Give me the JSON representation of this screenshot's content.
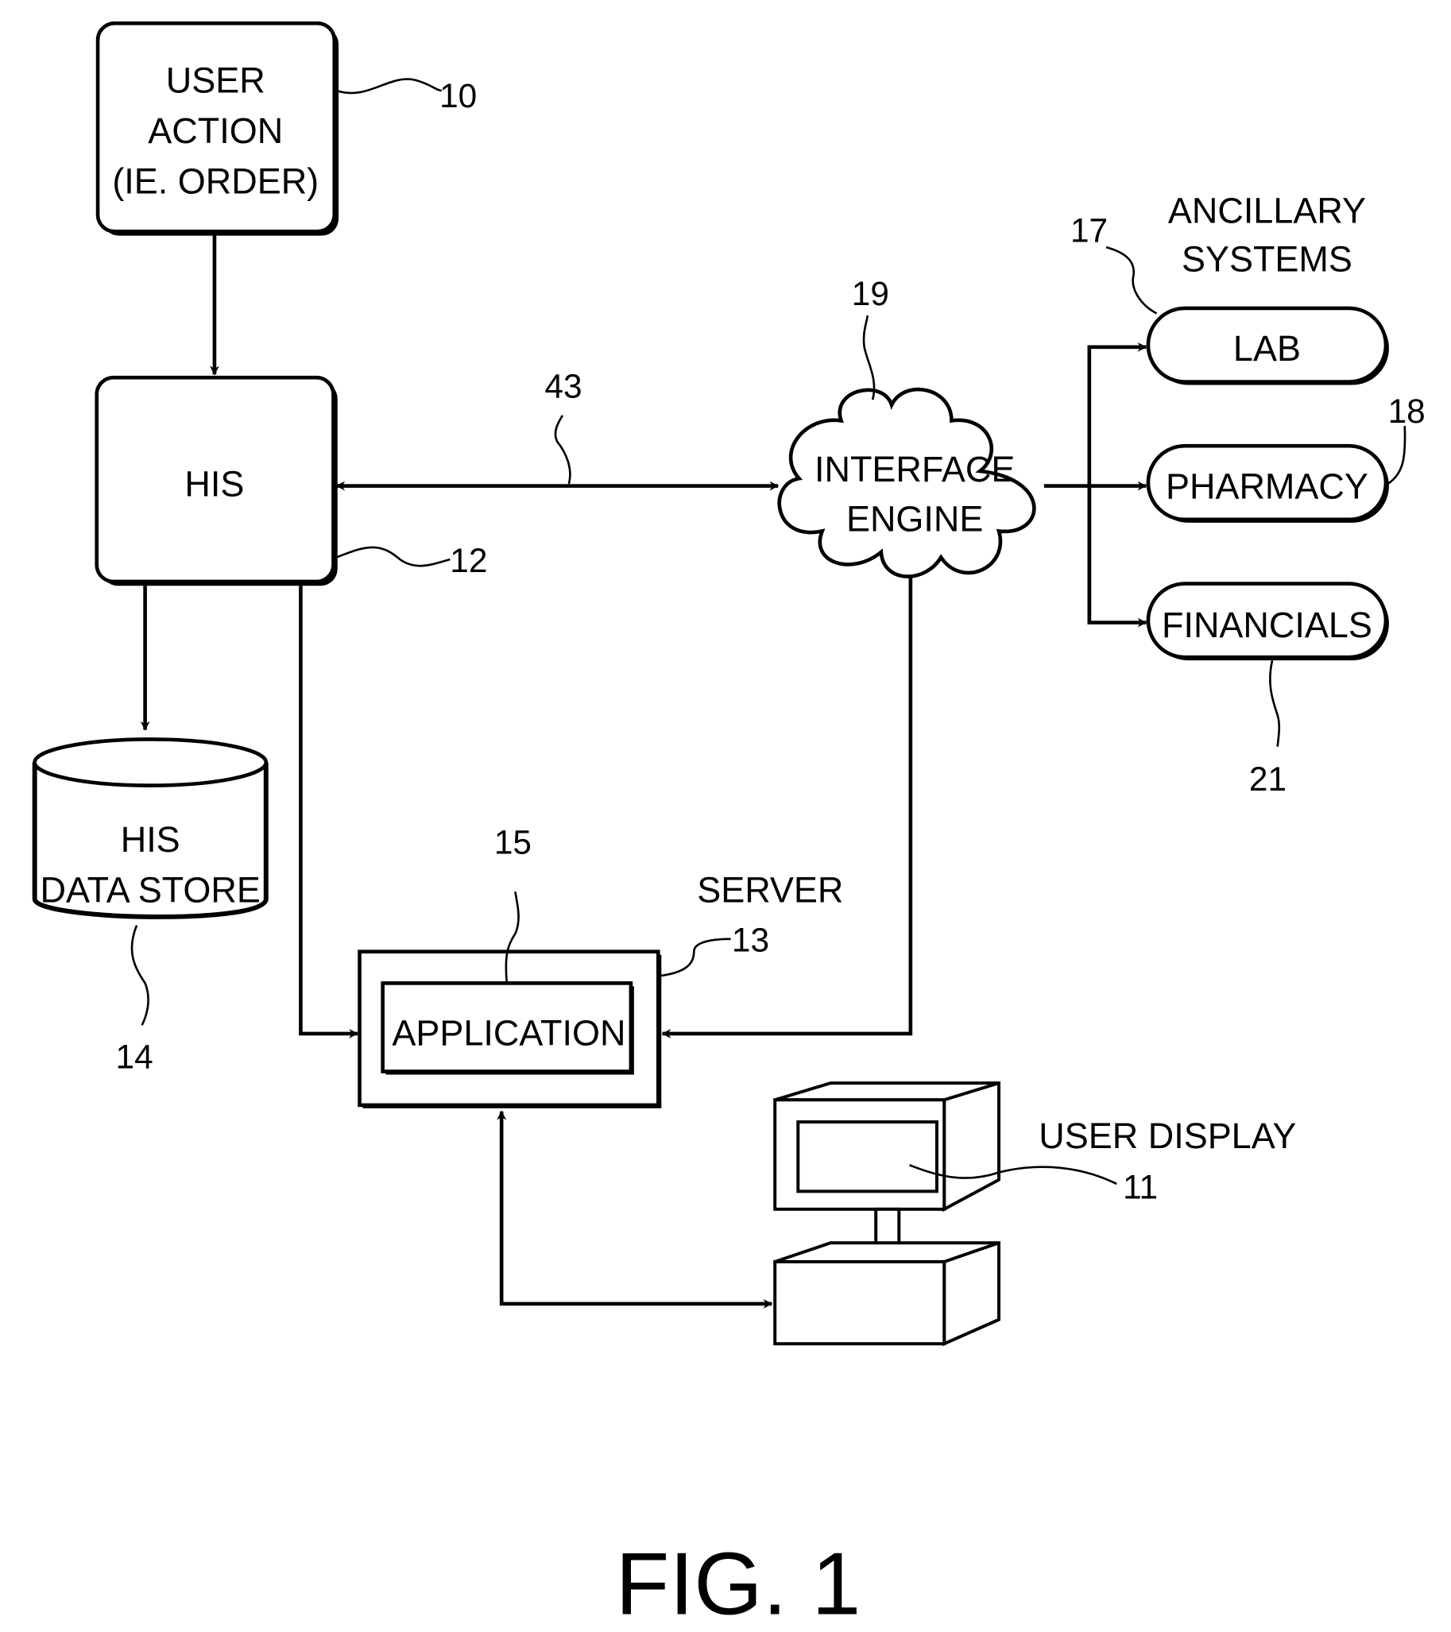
{
  "figure": {
    "caption": "FIG. 1",
    "colors": {
      "ink": "#000000",
      "paper": "#ffffff"
    }
  },
  "nodes": {
    "user_action": {
      "lines": [
        "USER",
        "ACTION",
        "(IE. ORDER)"
      ],
      "ref": "10"
    },
    "his": {
      "label": "HIS",
      "ref": "12"
    },
    "his_data_store": {
      "lines": [
        "HIS",
        "DATA STORE"
      ],
      "ref": "14"
    },
    "interface_engine": {
      "lines": [
        "INTERFACE",
        "ENGINE"
      ],
      "ref": "19"
    },
    "ancillary_systems": {
      "lines": [
        "ANCILLARY",
        "SYSTEMS"
      ]
    },
    "lab": {
      "label": "LAB",
      "ref": "17"
    },
    "pharmacy": {
      "label": "PHARMACY",
      "ref": "18"
    },
    "financials": {
      "label": "FINANCIALS",
      "ref": "21"
    },
    "server": {
      "label": "SERVER",
      "ref": "13"
    },
    "application": {
      "label": "APPLICATION",
      "ref": "15"
    },
    "user_display": {
      "label": "USER DISPLAY",
      "ref": "11"
    }
  },
  "connections": {
    "his_interface_link_ref": "43"
  }
}
